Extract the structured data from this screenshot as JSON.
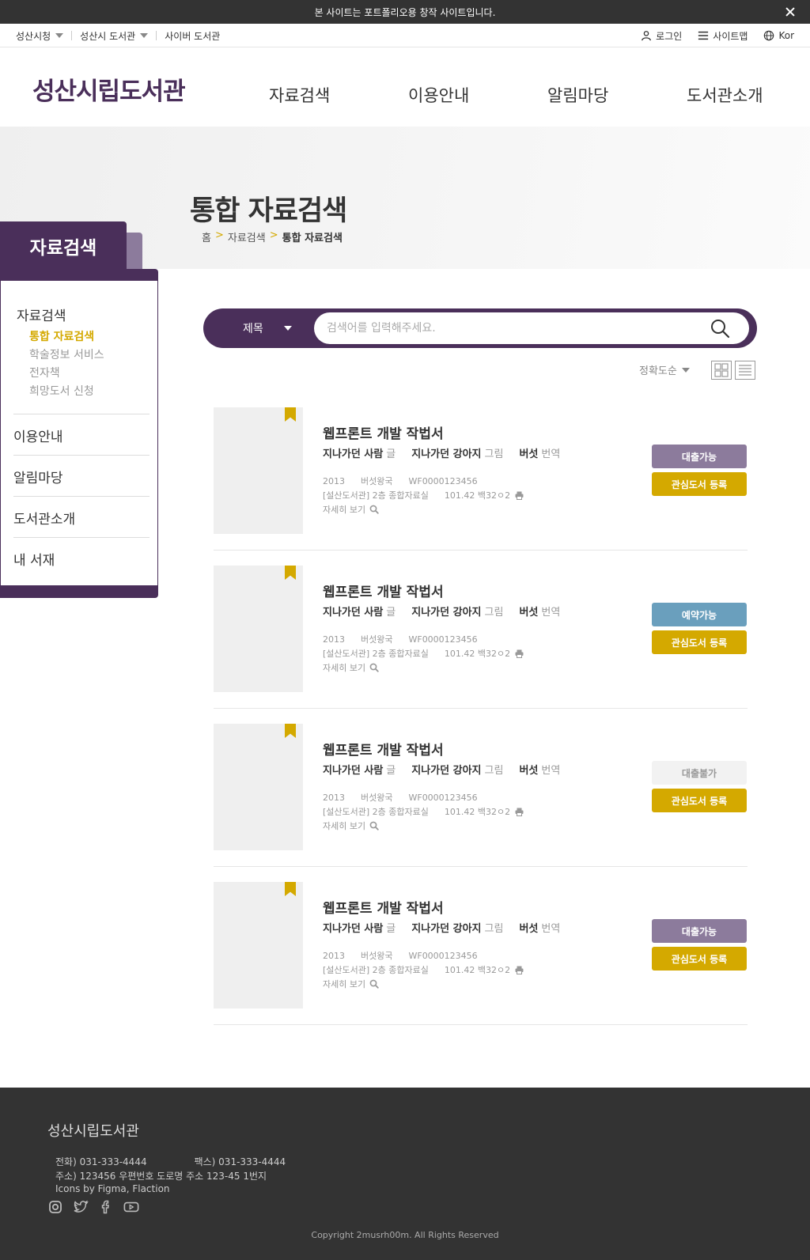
{
  "notice": {
    "text": "본 사이트는 포트폴리오용 창작 사이트입니다."
  },
  "util": {
    "left": [
      "성산시청",
      "성산시 도서관",
      "사이버 도서관"
    ],
    "login": "로그인",
    "sitemap": "사이트맵",
    "lang": "Kor"
  },
  "header": {
    "logo": "성산시립도서관",
    "nav": [
      "자료검색",
      "이용안내",
      "알림마당",
      "도서관소개"
    ]
  },
  "hero": {
    "title": "통합 자료검색",
    "breadcrumb": {
      "home": "홈",
      "section": "자료검색",
      "current": "통합 자료검색",
      "sep": ">"
    }
  },
  "side": {
    "tab": "자료검색",
    "group_title": "자료검색",
    "subs": [
      "통합 자료검색",
      "학술정보 서비스",
      "전자책",
      "희망도서 신청"
    ],
    "menus": [
      "이용안내",
      "알림마당",
      "도서관소개",
      "내 서재"
    ]
  },
  "search": {
    "select": "제목",
    "placeholder": "검색어를 입력해주세요."
  },
  "sort": {
    "label": "정확도순"
  },
  "results": [
    {
      "title": "웹프론트 개발 작법서",
      "author1": "지나가던 사람",
      "role1": "글",
      "author2": "지나가던 강아지",
      "role2": "그림",
      "author3": "버섯",
      "role3": "번역",
      "year": "2013",
      "publisher": "버섯왕국",
      "code": "WF0000123456",
      "location": "[설산도서관] 2층 종합자료실",
      "call_no": "101.42 백32ㅇ2",
      "detail": "자세히 보기",
      "status": "대출가능",
      "status_color": "#8c7b9c",
      "status_text_color": "#ffffff",
      "fav": "관심도서 등록"
    },
    {
      "title": "웹프론트 개발 작법서",
      "author1": "지나가던 사람",
      "role1": "글",
      "author2": "지나가던 강아지",
      "role2": "그림",
      "author3": "버섯",
      "role3": "번역",
      "year": "2013",
      "publisher": "버섯왕국",
      "code": "WF0000123456",
      "location": "[설산도서관] 2층 종합자료실",
      "call_no": "101.42 백32ㅇ2",
      "detail": "자세히 보기",
      "status": "예약가능",
      "status_color": "#6a9fbd",
      "status_text_color": "#ffffff",
      "fav": "관심도서 등록"
    },
    {
      "title": "웹프론트 개발 작법서",
      "author1": "지나가던 사람",
      "role1": "글",
      "author2": "지나가던 강아지",
      "role2": "그림",
      "author3": "버섯",
      "role3": "번역",
      "year": "2013",
      "publisher": "버섯왕국",
      "code": "WF0000123456",
      "location": "[설산도서관] 2층 종합자료실",
      "call_no": "101.42 백32ㅇ2",
      "detail": "자세히 보기",
      "status": "대출불가",
      "status_color": "#f2f2f2",
      "status_text_color": "#999999",
      "fav": "관심도서 등록"
    },
    {
      "title": "웹프론트 개발 작법서",
      "author1": "지나가던 사람",
      "role1": "글",
      "author2": "지나가던 강아지",
      "role2": "그림",
      "author3": "버섯",
      "role3": "번역",
      "year": "2013",
      "publisher": "버섯왕국",
      "code": "WF0000123456",
      "location": "[설산도서관] 2층 종합자료실",
      "call_no": "101.42 백32ㅇ2",
      "detail": "자세히 보기",
      "status": "대출가능",
      "status_color": "#8c7b9c",
      "status_text_color": "#ffffff",
      "fav": "관심도서 등록"
    }
  ],
  "footer": {
    "logo": "성산시립도서관",
    "phone": "전화) 031-333-4444",
    "fax": "팩스) 031-333-4444",
    "address": "주소) 123456 우편번호 도로명 주소 123-45 1번지",
    "credits": "Icons by Figma, Flaction",
    "copyright": "Copyright 2musrh00m. All Rights Reserved"
  },
  "colors": {
    "brand": "#4a2f5a",
    "accent": "#d4a900",
    "footer_bg": "#333333"
  },
  "icons": [
    "close-icon",
    "user-icon",
    "menu-icon",
    "globe-icon",
    "search-icon",
    "grid-view-icon",
    "list-view-icon",
    "bookmark-icon",
    "print-icon",
    "magnifier-icon",
    "instagram-icon",
    "twitter-icon",
    "facebook-icon",
    "youtube-icon"
  ]
}
